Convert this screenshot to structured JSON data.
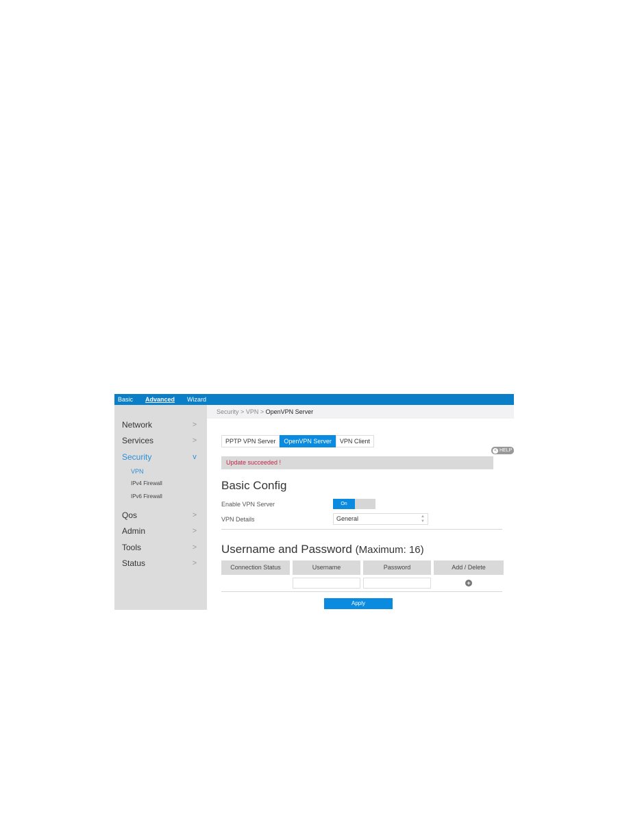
{
  "topnav": {
    "items": [
      {
        "label": "Basic",
        "active": false
      },
      {
        "label": "Advanced",
        "active": true
      },
      {
        "label": "Wizard",
        "active": false
      }
    ]
  },
  "sidebar": {
    "items": [
      {
        "label": "Network",
        "icon": "chevron-right-icon",
        "glyph": ">"
      },
      {
        "label": "Services",
        "icon": "chevron-right-icon",
        "glyph": ">"
      },
      {
        "label": "Security",
        "icon": "chevron-down-icon",
        "glyph": "v",
        "active": true
      },
      {
        "label": "Qos",
        "icon": "chevron-right-icon",
        "glyph": ">"
      },
      {
        "label": "Admin",
        "icon": "chevron-right-icon",
        "glyph": ">"
      },
      {
        "label": "Tools",
        "icon": "chevron-right-icon",
        "glyph": ">"
      },
      {
        "label": "Status",
        "icon": "chevron-right-icon",
        "glyph": ">"
      }
    ],
    "security_subitems": [
      {
        "label": "VPN",
        "active": true
      },
      {
        "label": "IPv4 Firewall",
        "active": false
      },
      {
        "label": "IPv6 Firewall",
        "active": false
      }
    ]
  },
  "breadcrumb": {
    "parts": [
      "Security",
      "VPN"
    ],
    "separator": ">",
    "current": "OpenVPN Server"
  },
  "tabs": [
    {
      "label": "PPTP VPN Server",
      "active": false
    },
    {
      "label": "OpenVPN Server",
      "active": true
    },
    {
      "label": "VPN Client",
      "active": false
    }
  ],
  "help": {
    "label": "HELP",
    "icon": "back-arrow-icon",
    "glyph": "<"
  },
  "message": {
    "text": "Update succeeded !",
    "color": "#c0264a"
  },
  "basic_config": {
    "title": "Basic Config",
    "enable_label": "Enable VPN Server",
    "toggle_value": "On",
    "details_label": "VPN Details",
    "details_value": "General",
    "details_arrows": "▲▼"
  },
  "users": {
    "title": "Username and Password",
    "subtitle": "(Maximum: 16)",
    "columns": [
      "Connection Status",
      "Username",
      "Password",
      "Add / Delete"
    ],
    "row": {
      "username": "",
      "password": "",
      "add_glyph": "+"
    }
  },
  "apply_label": "Apply",
  "colors": {
    "accent": "#0b8be0",
    "nav": "#0b7ec8",
    "sidebar": "#dcdcdc",
    "active_link": "#2b8fd6"
  }
}
